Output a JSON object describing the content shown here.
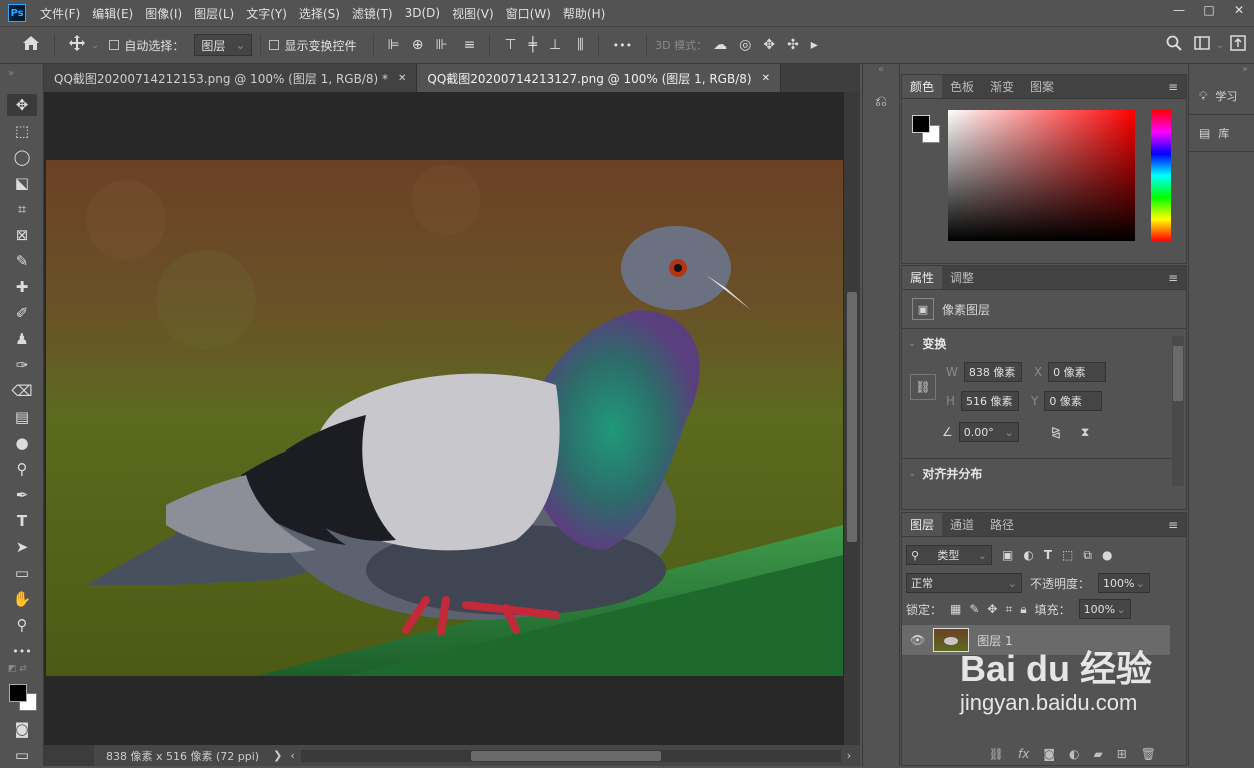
{
  "app": {
    "logo": "Ps"
  },
  "menu": [
    "文件(F)",
    "编辑(E)",
    "图像(I)",
    "图层(L)",
    "文字(Y)",
    "选择(S)",
    "滤镜(T)",
    "3D(D)",
    "视图(V)",
    "窗口(W)",
    "帮助(H)"
  ],
  "window_controls": {
    "minimize": "—",
    "restore": "□",
    "close": "✕"
  },
  "options": {
    "auto_select_label": "自动选择：",
    "auto_select_value": "图层",
    "show_transform_label": "显示变换控件",
    "more": "•••",
    "mode_3d_label": "3D 模式："
  },
  "tabs": [
    {
      "label": "QQ截图20200714212153.png @ 100% (图层 1, RGB/8) *",
      "close": "✕"
    },
    {
      "label": "QQ截图20200714213127.png @ 100% (图层 1, RGB/8)",
      "close": "✕"
    }
  ],
  "status": {
    "size": "838 像素 x 516 像素 (72 ppi)",
    "arrow": "❯",
    "left_arrow": "‹",
    "right_arrow": "›"
  },
  "color_panel": {
    "tabs": [
      "颜色",
      "色板",
      "渐变",
      "图案"
    ],
    "foreground": "#000000",
    "background": "#ffffff",
    "hue_color": "#ff0000"
  },
  "properties_panel": {
    "tabs": [
      "属性",
      "调整"
    ],
    "layer_type": "像素图层",
    "transform_title": "变换",
    "w_label": "W",
    "w_value": "838 像素",
    "h_label": "H",
    "h_value": "516 像素",
    "x_label": "X",
    "x_value": "0 像素",
    "y_label": "Y",
    "y_value": "0 像素",
    "angle_value": "0.00°",
    "align_title": "对齐并分布"
  },
  "layers_panel": {
    "tabs": [
      "图层",
      "通道",
      "路径"
    ],
    "filter_value": "类型",
    "blend_mode": "正常",
    "opacity_label": "不透明度：",
    "opacity_value": "100%",
    "lock_label": "锁定：",
    "fill_label": "填充：",
    "fill_value": "100%",
    "layers": [
      {
        "name": "图层 1"
      }
    ]
  },
  "right_rail": {
    "learn": "学习",
    "library": "库"
  },
  "watermark": {
    "brand": "Bai du 经验",
    "url": "jingyan.baidu.com"
  }
}
